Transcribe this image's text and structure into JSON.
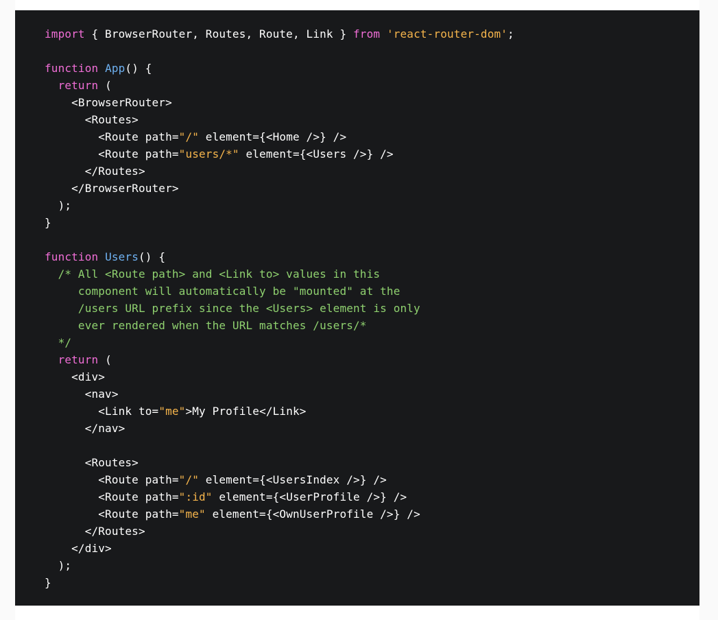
{
  "colors": {
    "background": "#18191b",
    "page": "#ffffff",
    "keyword": "#f06ed6",
    "function": "#6eb0f0",
    "string": "#f6b54c",
    "comment": "#8fd16f",
    "plain": "#ffffff"
  },
  "code": {
    "lines": [
      [
        {
          "t": "import",
          "k": "kw"
        },
        {
          "t": " { BrowserRouter, Routes, Route, Link } ",
          "k": "plain"
        },
        {
          "t": "from",
          "k": "kw"
        },
        {
          "t": " ",
          "k": "plain"
        },
        {
          "t": "'react-router-dom'",
          "k": "str"
        },
        {
          "t": ";",
          "k": "plain"
        }
      ],
      [],
      [
        {
          "t": "function",
          "k": "kw"
        },
        {
          "t": " ",
          "k": "plain"
        },
        {
          "t": "App",
          "k": "fn"
        },
        {
          "t": "() {",
          "k": "plain"
        }
      ],
      [
        {
          "t": "  ",
          "k": "plain"
        },
        {
          "t": "return",
          "k": "kw"
        },
        {
          "t": " (",
          "k": "plain"
        }
      ],
      [
        {
          "t": "    <BrowserRouter>",
          "k": "plain"
        }
      ],
      [
        {
          "t": "      <Routes>",
          "k": "plain"
        }
      ],
      [
        {
          "t": "        <Route path=",
          "k": "plain"
        },
        {
          "t": "\"/\"",
          "k": "str"
        },
        {
          "t": " element={<Home />} />",
          "k": "plain"
        }
      ],
      [
        {
          "t": "        <Route path=",
          "k": "plain"
        },
        {
          "t": "\"users/*\"",
          "k": "str"
        },
        {
          "t": " element={<Users />} />",
          "k": "plain"
        }
      ],
      [
        {
          "t": "      </Routes>",
          "k": "plain"
        }
      ],
      [
        {
          "t": "    </BrowserRouter>",
          "k": "plain"
        }
      ],
      [
        {
          "t": "  );",
          "k": "plain"
        }
      ],
      [
        {
          "t": "}",
          "k": "plain"
        }
      ],
      [],
      [
        {
          "t": "function",
          "k": "kw"
        },
        {
          "t": " ",
          "k": "plain"
        },
        {
          "t": "Users",
          "k": "fn"
        },
        {
          "t": "() {",
          "k": "plain"
        }
      ],
      [
        {
          "t": "  /* All <Route path> and <Link to> values in this",
          "k": "cm"
        }
      ],
      [
        {
          "t": "     component will automatically be \"mounted\" at the",
          "k": "cm"
        }
      ],
      [
        {
          "t": "     /users URL prefix since the <Users> element is only",
          "k": "cm"
        }
      ],
      [
        {
          "t": "     ever rendered when the URL matches /users/*",
          "k": "cm"
        }
      ],
      [
        {
          "t": "  */",
          "k": "cm"
        }
      ],
      [
        {
          "t": "  ",
          "k": "plain"
        },
        {
          "t": "return",
          "k": "kw"
        },
        {
          "t": " (",
          "k": "plain"
        }
      ],
      [
        {
          "t": "    <div>",
          "k": "plain"
        }
      ],
      [
        {
          "t": "      <nav>",
          "k": "plain"
        }
      ],
      [
        {
          "t": "        <Link to=",
          "k": "plain"
        },
        {
          "t": "\"me\"",
          "k": "str"
        },
        {
          "t": ">My Profile</Link>",
          "k": "plain"
        }
      ],
      [
        {
          "t": "      </nav>",
          "k": "plain"
        }
      ],
      [],
      [
        {
          "t": "      <Routes>",
          "k": "plain"
        }
      ],
      [
        {
          "t": "        <Route path=",
          "k": "plain"
        },
        {
          "t": "\"/\"",
          "k": "str"
        },
        {
          "t": " element={<UsersIndex />} />",
          "k": "plain"
        }
      ],
      [
        {
          "t": "        <Route path=",
          "k": "plain"
        },
        {
          "t": "\":id\"",
          "k": "str"
        },
        {
          "t": " element={<UserProfile />} />",
          "k": "plain"
        }
      ],
      [
        {
          "t": "        <Route path=",
          "k": "plain"
        },
        {
          "t": "\"me\"",
          "k": "str"
        },
        {
          "t": " element={<OwnUserProfile />} />",
          "k": "plain"
        }
      ],
      [
        {
          "t": "      </Routes>",
          "k": "plain"
        }
      ],
      [
        {
          "t": "    </div>",
          "k": "plain"
        }
      ],
      [
        {
          "t": "  );",
          "k": "plain"
        }
      ],
      [
        {
          "t": "}",
          "k": "plain"
        }
      ]
    ]
  }
}
